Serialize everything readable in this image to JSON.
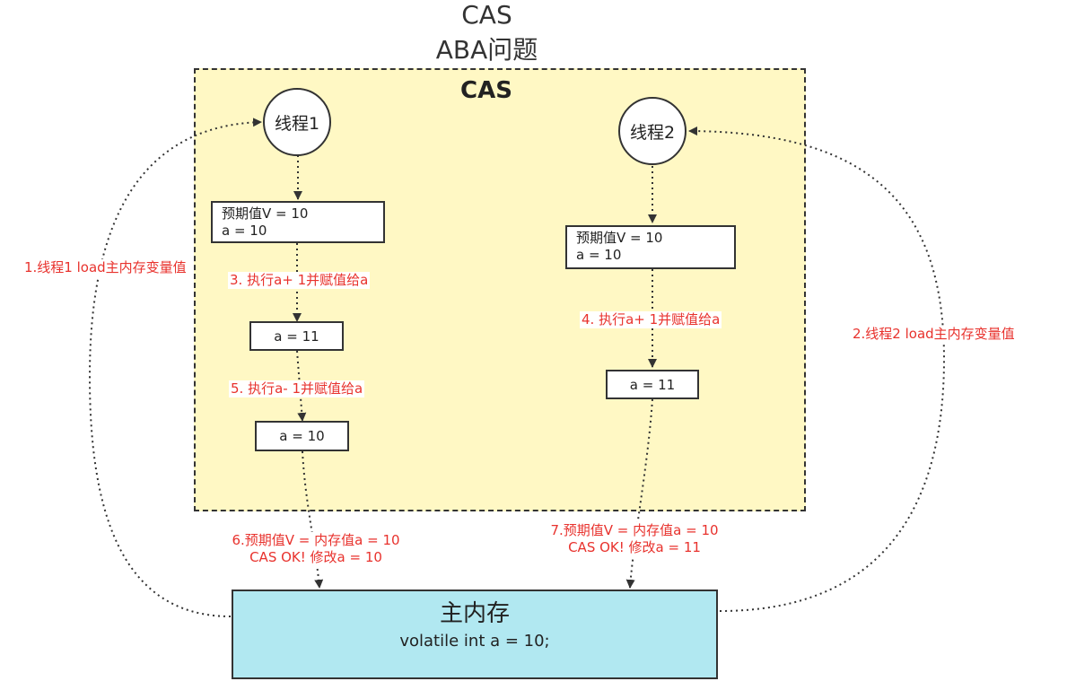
{
  "title": {
    "line1": "CAS",
    "line2": "ABA问题"
  },
  "container": {
    "label": "CAS"
  },
  "thread1": {
    "name": "线程1",
    "expected_line1": "预期值V = 10",
    "expected_line2": "a = 10",
    "step3": "3. 执行a+ 1并赋值给a",
    "value_after_inc": "a = 11",
    "step5": "5. 执行a- 1并赋值给a",
    "value_after_dec": "a = 10"
  },
  "thread2": {
    "name": "线程2",
    "expected_line1": "预期值V = 10",
    "expected_line2": "a = 10",
    "step4": "4. 执行a+ 1并赋值给a",
    "value_after_inc": "a = 11"
  },
  "edges": {
    "load1": "1.线程1 load主内存变量值",
    "load2": "2.线程2 load主内存变量值",
    "step6_line1": "6.预期值V = 内存值a = 10",
    "step6_line2": "CAS OK!  修改a = 10",
    "step7_line1": "7.预期值V = 内存值a = 10",
    "step7_line2": "CAS OK!  修改a = 11"
  },
  "main_memory": {
    "title": "主内存",
    "code": "volatile int a = 10;"
  },
  "colors": {
    "container_fill": "#fff8c4",
    "memory_fill": "#b1e8f1",
    "annotation": "#e8322d",
    "stroke": "#333333"
  }
}
